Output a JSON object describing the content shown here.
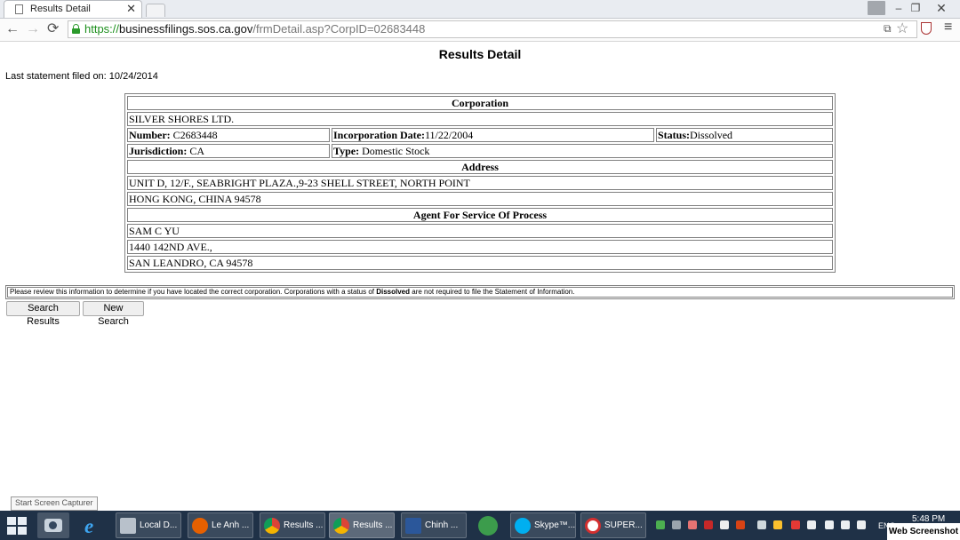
{
  "browser": {
    "tab_title": "Results Detail",
    "tab_close": "✕",
    "url_scheme": "https://",
    "url_host": "businessfilings.sos.ca.gov",
    "url_path": "/frmDetail.asp?CorpID=02683448",
    "nav_back": "←",
    "nav_forward": "→",
    "nav_reload": "⟳",
    "star": "☆",
    "menu": "≡",
    "translate": "⧉",
    "win_min": "–",
    "win_max": "❐",
    "win_close": "✕",
    "user_glyph": "👤"
  },
  "page": {
    "title": "Results Detail",
    "last_filed_label": "Last statement filed on:",
    "last_filed_date": "10/24/2014"
  },
  "corporation": {
    "header": "Corporation",
    "name": "SILVER SHORES LTD.",
    "number_label": "Number:",
    "number_value": " C2683448",
    "inc_date_label": "Incorporation Date:",
    "inc_date_value": "11/22/2004",
    "status_label": "Status:",
    "status_value": "Dissolved",
    "jurisdiction_label": "Jurisdiction:",
    "jurisdiction_value": " CA",
    "type_label": "Type:",
    "type_value": " Domestic Stock"
  },
  "address": {
    "header": "Address",
    "line1": "UNIT D, 12/F., SEABRIGHT PLAZA.,9-23 SHELL STREET, NORTH POINT",
    "line2": "HONG KONG, CHINA  94578"
  },
  "agent": {
    "header": "Agent For Service Of Process",
    "name": "SAM C YU",
    "line1": "1440 142ND AVE.,",
    "line2": "SAN LEANDRO, CA  94578"
  },
  "notice": {
    "text_before": "Please review this information to determine if you have located the correct corporation.  Corporations with a status of ",
    "bold": "Dissolved",
    "text_after": " are not required to file the Statement of Information."
  },
  "buttons": {
    "search_results": "Search Results",
    "new_search": "New Search"
  },
  "tooltip": "Start Screen Capturer",
  "taskbar": {
    "tasks": [
      {
        "label": "Local D...",
        "icon": "computer-icon"
      },
      {
        "label": "Le Anh ...",
        "icon": "firefox-icon"
      },
      {
        "label": "Results ...",
        "icon": "chrome-icon"
      },
      {
        "label": "Results ...",
        "icon": "chrome-icon"
      },
      {
        "label": "Chinh ...",
        "icon": "word-icon"
      },
      {
        "label": "Skype™...",
        "icon": "skype-icon"
      },
      {
        "label": "SUPER...",
        "icon": "no-entry-icon"
      }
    ],
    "lang": "ENG",
    "time": "5:48 PM"
  },
  "watermark": "Web Screenshot",
  "colors": {
    "url_green": "#1c8f1c",
    "taskbar_bg": "#1f3147",
    "table_border": "#808080"
  }
}
